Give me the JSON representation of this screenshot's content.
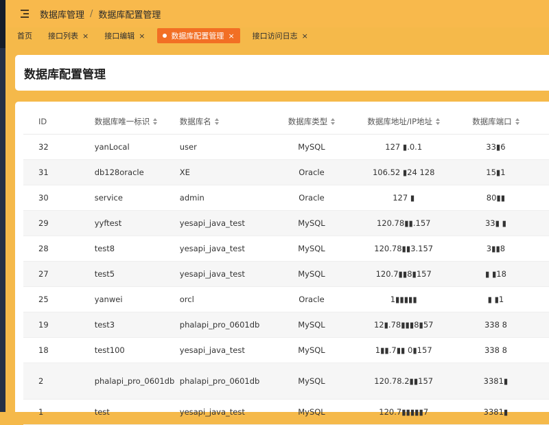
{
  "breadcrumb": [
    "数据库管理",
    "数据库配置管理"
  ],
  "tabs": [
    {
      "label": "首页",
      "closable": false,
      "active": false
    },
    {
      "label": "接口列表",
      "closable": true,
      "active": false
    },
    {
      "label": "接口编辑",
      "closable": true,
      "active": false
    },
    {
      "label": "数据库配置管理",
      "closable": true,
      "active": true
    },
    {
      "label": "接口访问日志",
      "closable": true,
      "active": false
    }
  ],
  "page_title": "数据库配置管理",
  "table": {
    "columns": [
      "ID",
      "数据库唯一标识",
      "数据库名",
      "数据库类型",
      "数据库地址/IP地址",
      "数据库端口"
    ],
    "rows": [
      {
        "id": "32",
        "key": "yanLocal",
        "name": "user",
        "type": "MySQL",
        "host": "127 ▮.0.1",
        "port": "33▮6"
      },
      {
        "id": "31",
        "key": "db128oracle",
        "name": "XE",
        "type": "Oracle",
        "host": "106.52 ▮24 128",
        "port": "15▮1"
      },
      {
        "id": "30",
        "key": "service",
        "name": "admin",
        "type": "Oracle",
        "host": "127 ▮",
        "port": "80▮▮"
      },
      {
        "id": "29",
        "key": "yyftest",
        "name": "yesapi_java_test",
        "type": "MySQL",
        "host": "120.78▮▮.157",
        "port": "33▮ ▮"
      },
      {
        "id": "28",
        "key": "test8",
        "name": "yesapi_java_test",
        "type": "MySQL",
        "host": "120.78▮▮3.157",
        "port": "3▮▮8"
      },
      {
        "id": "27",
        "key": "test5",
        "name": "yesapi_java_test",
        "type": "MySQL",
        "host": "120.7▮▮8▮157",
        "port": "▮ ▮18"
      },
      {
        "id": "25",
        "key": "yanwei",
        "name": "orcl",
        "type": "Oracle",
        "host": "1▮▮▮▮▮",
        "port": "▮ ▮1"
      },
      {
        "id": "19",
        "key": "test3",
        "name": "phalapi_pro_0601db",
        "type": "MySQL",
        "host": "12▮.78▮▮▮8▮57",
        "port": "338 8"
      },
      {
        "id": "18",
        "key": "test100",
        "name": "yesapi_java_test",
        "type": "MySQL",
        "host": "1▮▮.7▮▮ 0▮157",
        "port": "338 8"
      },
      {
        "id": "2",
        "key": "phalapi_pro_0601db",
        "name": "phalapi_pro_0601db",
        "type": "MySQL",
        "host": "120.78.2▮▮157",
        "port": "3381▮"
      },
      {
        "id": "1",
        "key": "test",
        "name": "yesapi_java_test",
        "type": "MySQL",
        "host": "120.7▮▮▮▮▮7",
        "port": "3381▮"
      }
    ]
  }
}
